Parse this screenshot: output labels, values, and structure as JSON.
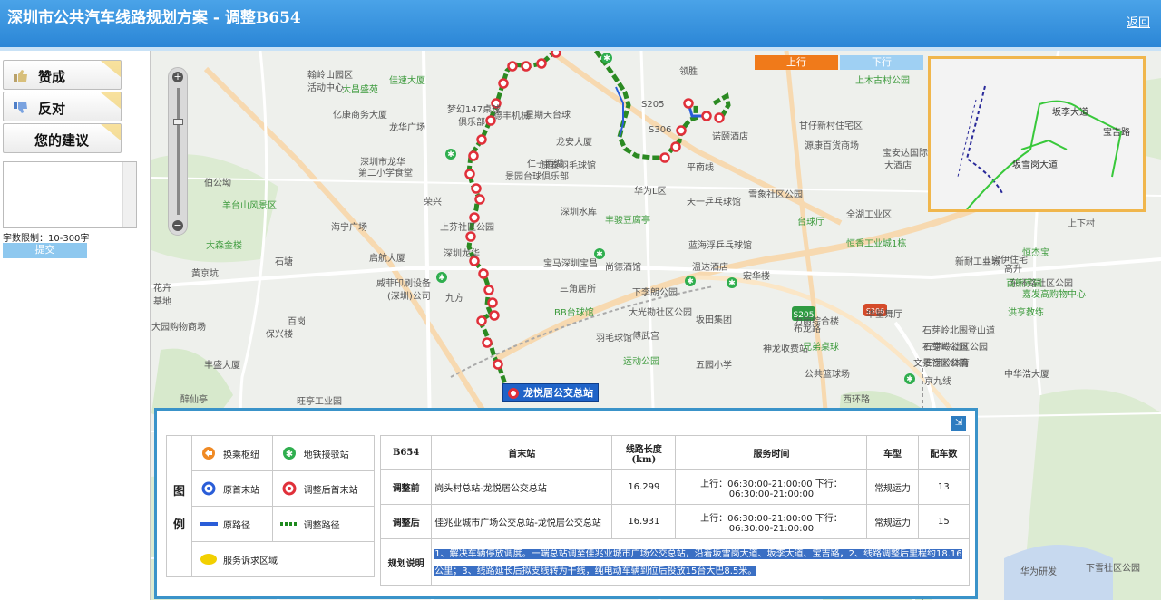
{
  "header": {
    "title": "深圳市公共汽车线路规划方案  - 调整B654",
    "back_label": "返回"
  },
  "sidebar": {
    "buttons": [
      {
        "label": "赞成",
        "icon": "thumbs-up-icon"
      },
      {
        "label": "反对",
        "icon": "thumbs-down-icon"
      },
      {
        "label": "您的建议",
        "icon": ""
      }
    ],
    "suggestion_value": "",
    "limit_text": "字数限制：10-300字",
    "submit_label": "提交"
  },
  "map": {
    "direction_tabs": {
      "up": "上行",
      "down": "下行"
    },
    "callout_label": "龙悦居公交总站",
    "labels": [
      "翰岭山园区",
      "佳速大厦",
      "大昌盛苑",
      "活动中心",
      "亿康商务大厦",
      "梦幻147桌球",
      "俱乐部",
      "龙华广场",
      "深圳市龙华",
      "第二小学食堂",
      "伯公坳",
      "羊台山风景区",
      "海宁广场",
      "荣兴",
      "大森金楼",
      "石塘",
      "黄京坑",
      "花卉",
      "基地",
      "大园购物商场",
      "保兴楼",
      "丰盛大厦",
      "醉仙亭",
      "旺亭工业园",
      "威菲印刷设备",
      "(深圳)公司",
      "九方",
      "启航大厦",
      "百岗",
      "星期天台球",
      "龙安大厦",
      "康泰羽毛球馆",
      "景园台球俱乐部",
      "华为L区",
      "天一乒乓球馆",
      "雪象社区公园",
      "台球厅",
      "丰骏豆腐亭",
      "上芬社区公园",
      "深圳龙华",
      "宝马深圳宝昌",
      "尚德酒馆",
      "三角居所",
      "BB台球馆",
      "蓝海浮乒乓球馆",
      "温达酒店",
      "宏华楼",
      "大光勘社区公园",
      "坂田集团",
      "羽毛球馆",
      "傅武宫",
      "运动公园",
      "五园小学",
      "布龙路",
      "神龙收费站",
      "兄弟桌球",
      "公共篮球场",
      "西环路",
      "京九线",
      "上木古村公园",
      "领胜",
      "甘仔新村住宅区",
      "源康百货商场",
      "宝安达国际",
      "大酒店",
      "全湖工业区",
      "恒香工业城1栋",
      "新耐工业城",
      "石芽岭北围登山道",
      "石芽岭社区公园",
      "石芽岭体育",
      "石芽岭公园",
      "文景社区公园",
      "中华浩大厦",
      "东环路社区公园",
      "百熊家园",
      "恒杰宝",
      "嘉发高购物中心",
      "洪亨教练",
      "高升",
      "上下村",
      "三实伊住宅",
      "力丽综合楼",
      "华星舞厅",
      "下李朗公园",
      "S205",
      "S306",
      "平南线",
      "诺颐酒店",
      "华为研发",
      "下雪社区公园",
      "德丰机械",
      "仁子西湖",
      "深圳水库"
    ]
  },
  "inset": {
    "labels": [
      "坂李大道",
      "宝吉路",
      "坂雪岗大道"
    ]
  },
  "legend": {
    "heading": [
      "图",
      "例"
    ],
    "items": [
      {
        "label": "换乘枢纽",
        "icon": "transfer-hub-icon"
      },
      {
        "label": "地铁接驳站",
        "icon": "metro-station-icon"
      },
      {
        "label": "原首末站",
        "icon": "original-terminal-icon"
      },
      {
        "label": "调整后首末站",
        "icon": "adjusted-terminal-icon"
      },
      {
        "label": "原路径",
        "icon": "original-route-icon"
      },
      {
        "label": "调整路径",
        "icon": "adjusted-route-icon"
      },
      {
        "label": "服务诉求区域",
        "icon": "service-area-icon"
      }
    ],
    "colors": {
      "original_route": "#2a5dd8",
      "adjusted_route": "#1e8a1e",
      "terminal_red": "#e0303a",
      "service_area": "#f2d000",
      "transfer_orange": "#f08a24",
      "metro_green": "#2fae4e"
    }
  },
  "route_table": {
    "headers": [
      "B654",
      "首末站",
      "线路长度\n(km)",
      "服务时间",
      "车型",
      "配车数"
    ],
    "rows": [
      {
        "label": "调整前",
        "stops": "岗头村总站-龙悦居公交总站",
        "length": "16.299",
        "time": "上行：06:30:00-21:00:00 下行：06:30:00-21:00:00",
        "type": "常规运力",
        "count": "13"
      },
      {
        "label": "调整后",
        "stops": "佳兆业城市广场公交总站-龙悦居公交总站",
        "length": "16.931",
        "time": "上行：06:30:00-21:00:00 下行：06:30:00-21:00:00",
        "type": "常规运力",
        "count": "15"
      }
    ],
    "plan_label": "规划说明",
    "plan_text": "1、解决车辆停放调度。一端总站调至佳兆业城市广场公交总站，沿着坂雪岗大道、坂李大道、宝吉路，2、线路调整后里程约18.16公里；3、线路延长后拟支线转为干线，纯电动车辆到位后投放15台大巴8.5米。"
  }
}
